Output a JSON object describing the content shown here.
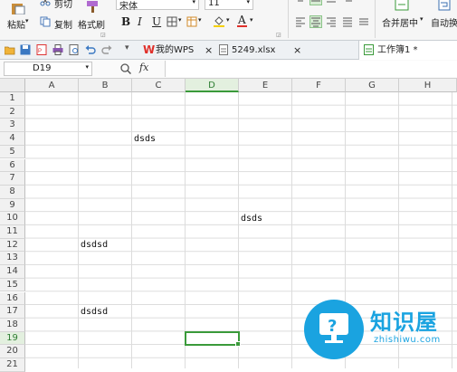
{
  "ribbon": {
    "cut_label": "剪切",
    "paste_label": "粘贴",
    "copy_label": "复制",
    "format_painter_label": "格式刷",
    "font_name": "宋体",
    "font_size": "11",
    "bold_label": "B",
    "italic_label": "I",
    "underline_label": "U",
    "font_color_label": "A",
    "merge_center_label": "合并居中",
    "auto_wrap_label": "自动换"
  },
  "tabs": [
    {
      "label": "我的WPS",
      "close": "×"
    },
    {
      "label": "5249.xlsx",
      "close": "×"
    },
    {
      "label": "工作簿1 *"
    }
  ],
  "formula_bar": {
    "name_box": "D19",
    "fx_label": "fx",
    "value": ""
  },
  "columns": [
    "A",
    "B",
    "C",
    "D",
    "E",
    "F",
    "G",
    "H"
  ],
  "rows": [
    "1",
    "2",
    "3",
    "4",
    "5",
    "6",
    "7",
    "8",
    "9",
    "10",
    "11",
    "12",
    "13",
    "14",
    "15",
    "16",
    "17",
    "18",
    "19",
    "20",
    "21"
  ],
  "cells": [
    {
      "ref": "C4",
      "value": "dsds"
    },
    {
      "ref": "E10",
      "value": "dsds"
    },
    {
      "ref": "B12",
      "value": "dsdsd"
    },
    {
      "ref": "B17",
      "value": "dsdsd"
    }
  ],
  "selected_cell": "D19",
  "watermark": {
    "title": "知识屋",
    "url": "zhishiwu.com",
    "icon": "question-mark-monitor-icon",
    "brand_color": "#1aa3e0"
  },
  "colors": {
    "accent_green": "#3a9a3a",
    "wps_red": "#e0302a"
  }
}
